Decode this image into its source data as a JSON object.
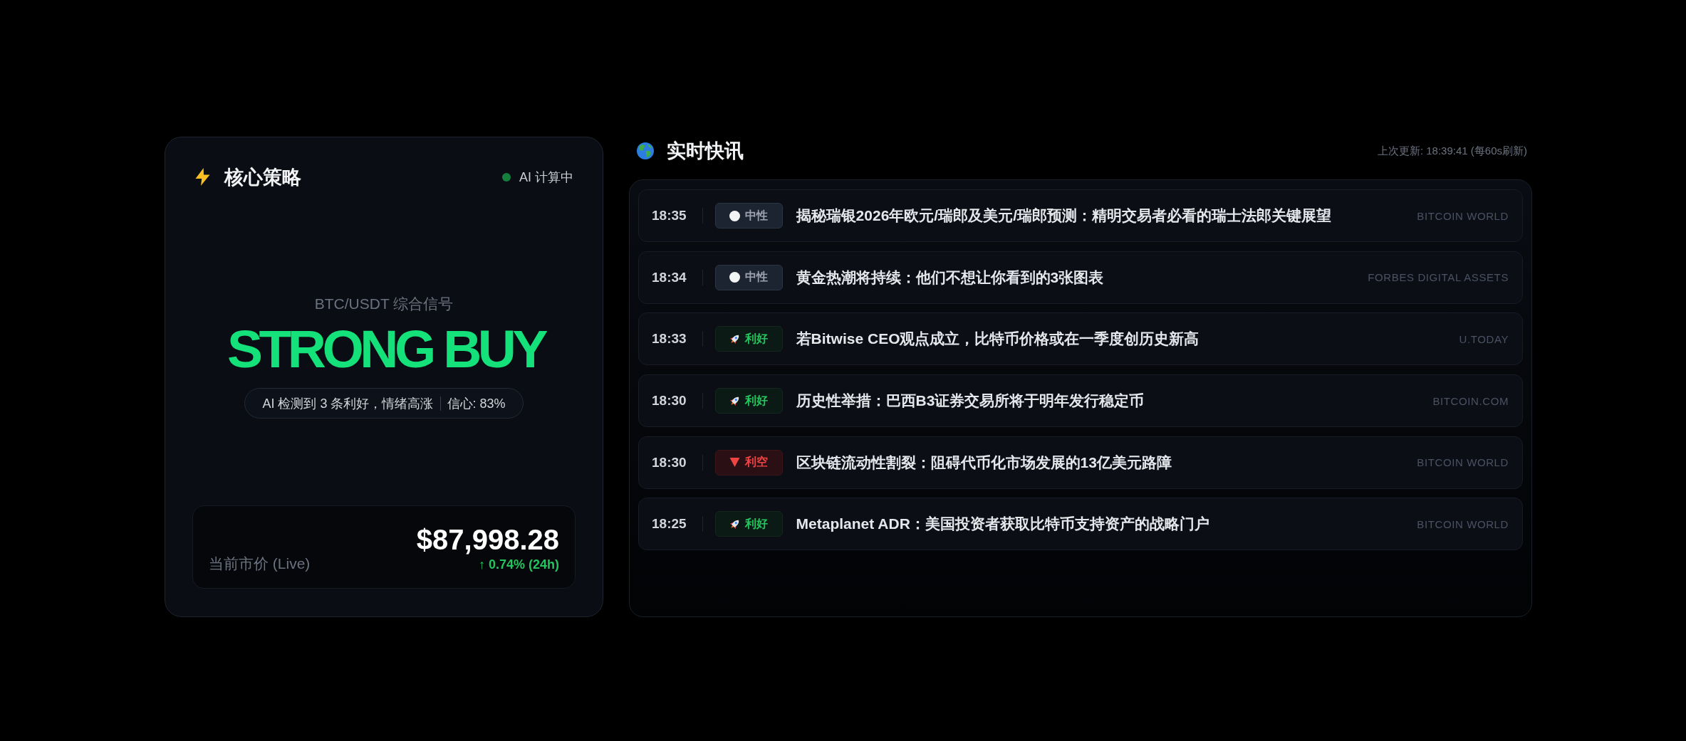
{
  "strategy": {
    "title": "核心策略",
    "status": {
      "label": "AI 计算中",
      "on": true
    },
    "pair_label": "BTC/USDT 综合信号",
    "signal": "STRONG BUY",
    "summary": "AI 检测到 3 条利好，情绪高涨",
    "confidence": "信心: 83%",
    "price": {
      "label": "当前市价 (Live)",
      "value": "$87,998.28",
      "change": "↑ 0.74% (24h)"
    }
  },
  "news": {
    "title": "实时快讯",
    "last_updated": "上次更新: 18:39:41 (每60s刷新)",
    "items": [
      {
        "time": "18:35",
        "kind": "neutral",
        "tag": "中性",
        "headline": "揭秘瑞银2026年欧元/瑞郎及美元/瑞郎预测：精明交易者必看的瑞士法郎关键展望",
        "source": "BITCOIN WORLD"
      },
      {
        "time": "18:34",
        "kind": "neutral",
        "tag": "中性",
        "headline": "黄金热潮将持续：他们不想让你看到的3张图表",
        "source": "FORBES DIGITAL ASSETS"
      },
      {
        "time": "18:33",
        "kind": "bullish",
        "tag": "利好",
        "headline": "若Bitwise CEO观点成立，比特币价格或在一季度创历史新高",
        "source": "U.TODAY"
      },
      {
        "time": "18:30",
        "kind": "bullish",
        "tag": "利好",
        "headline": "历史性举措：巴西B3证券交易所将于明年发行稳定币",
        "source": "BITCOIN.COM"
      },
      {
        "time": "18:30",
        "kind": "bearish",
        "tag": "利空",
        "headline": "区块链流动性割裂：阻碍代币化市场发展的13亿美元路障",
        "source": "BITCOIN WORLD"
      },
      {
        "time": "18:25",
        "kind": "bullish",
        "tag": "利好",
        "headline": "Metaplanet ADR：美国投资者获取比特币支持资产的战略门户",
        "source": "BITCOIN WORLD"
      }
    ]
  }
}
